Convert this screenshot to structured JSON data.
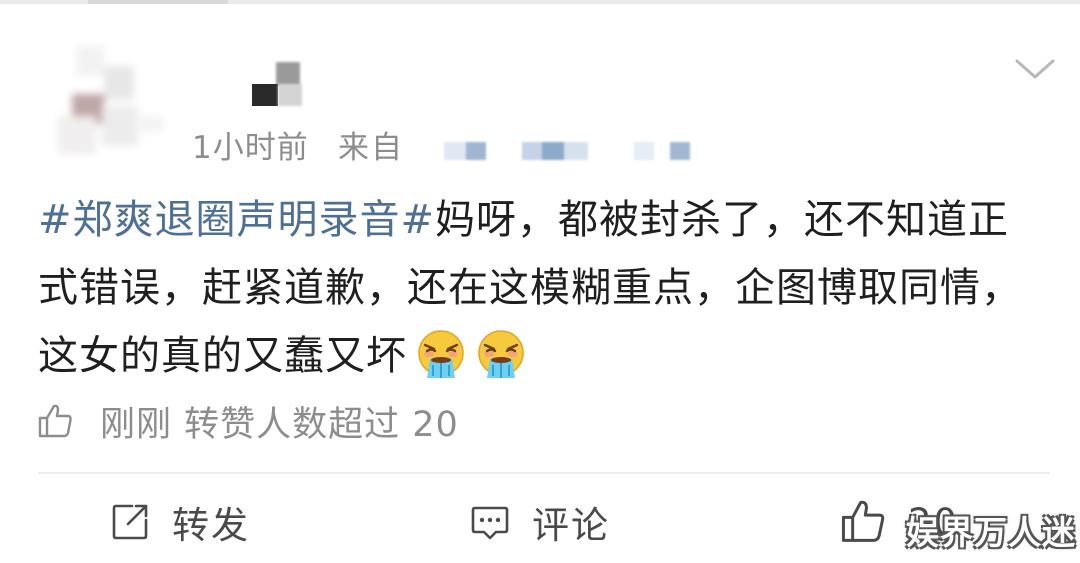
{
  "post": {
    "time": "1小时前",
    "from_label": "来自",
    "hashtag": "#郑爽退圈声明录音#",
    "body": "妈呀，都被封杀了，还不知道正式错误，赶紧道歉，还在这模糊重点，企图博取同情，这女的真的又蠢又坏",
    "emojis": [
      "vomit-emoji",
      "vomit-emoji"
    ]
  },
  "stats": {
    "icon": "thumbs-up-icon",
    "text": "刚刚 转赞人数超过 20"
  },
  "actions": {
    "repost_label": "转发",
    "comment_label": "评论",
    "like_count": "20"
  },
  "watermark": "娱界万人迷",
  "colors": {
    "hashtag": "#4e6f96",
    "meta_gray": "#8d8d8d",
    "text": "#1f1f1f"
  }
}
